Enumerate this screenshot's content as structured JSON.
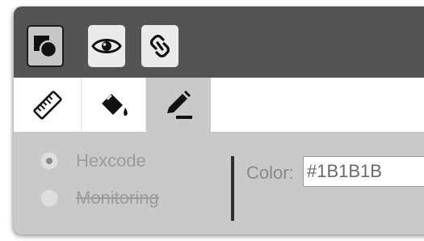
{
  "toolbar": {
    "buttons": [
      {
        "name": "shapes-icon",
        "active": true
      },
      {
        "name": "eye-icon",
        "active": false
      },
      {
        "name": "link-icon",
        "active": false
      }
    ]
  },
  "tabs": [
    {
      "name": "ruler-icon",
      "active": false
    },
    {
      "name": "paint-bucket-icon",
      "active": false
    },
    {
      "name": "pen-icon",
      "active": true
    }
  ],
  "mode": {
    "options": [
      {
        "label": "Hexcode",
        "checked": true,
        "strikethrough": false
      },
      {
        "label": "Monitoring",
        "checked": false,
        "strikethrough": true
      }
    ]
  },
  "color": {
    "label": "Color:",
    "value": "#1B1B1B"
  }
}
